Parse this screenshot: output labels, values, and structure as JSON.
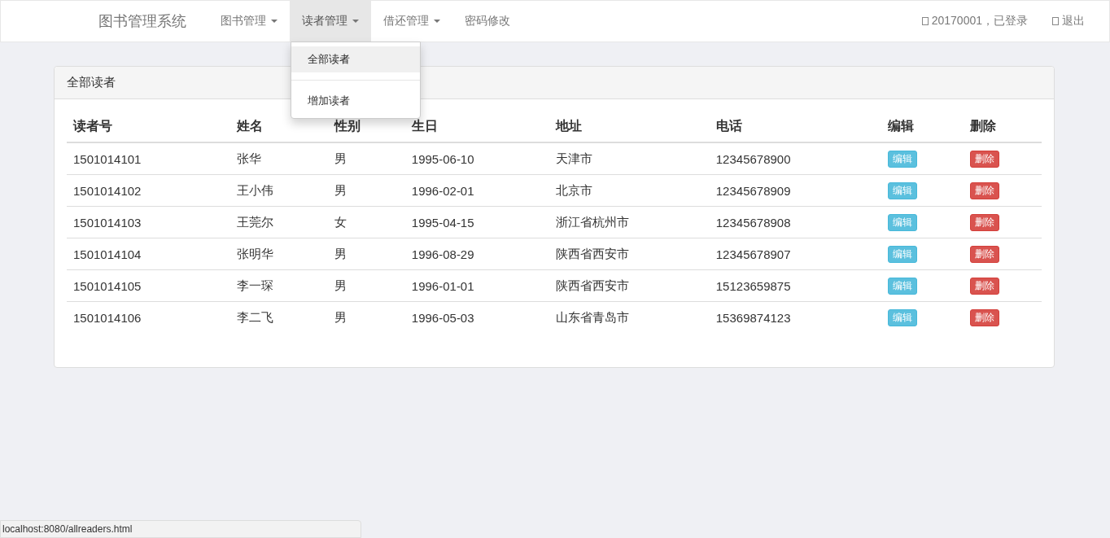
{
  "navbar": {
    "brand": "图书管理系统",
    "menus": [
      {
        "label": "图书管理",
        "has_caret": true,
        "selected": false
      },
      {
        "label": "读者管理",
        "has_caret": true,
        "selected": true
      },
      {
        "label": "借还管理",
        "has_caret": true,
        "selected": false
      },
      {
        "label": "密码修改",
        "has_caret": false,
        "selected": false
      }
    ],
    "user": "20170001，已登录",
    "logout": "退出"
  },
  "dropdown": {
    "items": [
      {
        "label": "全部读者",
        "selected": true
      },
      {
        "label": "增加读者",
        "selected": false
      }
    ]
  },
  "panel": {
    "title": "全部读者",
    "table": {
      "columns": [
        "读者号",
        "姓名",
        "性别",
        "生日",
        "地址",
        "电话",
        "编辑",
        "删除"
      ],
      "rows": [
        {
          "cells": [
            "1501014101",
            "张华",
            "男",
            "1995-06-10",
            "天津市",
            "12345678900"
          ],
          "edit": "编辑",
          "delete": "删除"
        },
        {
          "cells": [
            "1501014102",
            "王小伟",
            "男",
            "1996-02-01",
            "北京市",
            "12345678909"
          ],
          "edit": "编辑",
          "delete": "删除"
        },
        {
          "cells": [
            "1501014103",
            "王莞尔",
            "女",
            "1995-04-15",
            "浙江省杭州市",
            "12345678908"
          ],
          "edit": "编辑",
          "delete": "删除"
        },
        {
          "cells": [
            "1501014104",
            "张明华",
            "男",
            "1996-08-29",
            "陕西省西安市",
            "12345678907"
          ],
          "edit": "编辑",
          "delete": "删除"
        },
        {
          "cells": [
            "1501014105",
            "李一琛",
            "男",
            "1996-01-01",
            "陕西省西安市",
            "15123659875"
          ],
          "edit": "编辑",
          "delete": "删除"
        },
        {
          "cells": [
            "1501014106",
            "李二飞",
            "男",
            "1996-05-03",
            "山东省青岛市",
            "15369874123"
          ],
          "edit": "编辑",
          "delete": "删除"
        }
      ]
    }
  },
  "status_bar": "localhost:8080/allreaders.html"
}
